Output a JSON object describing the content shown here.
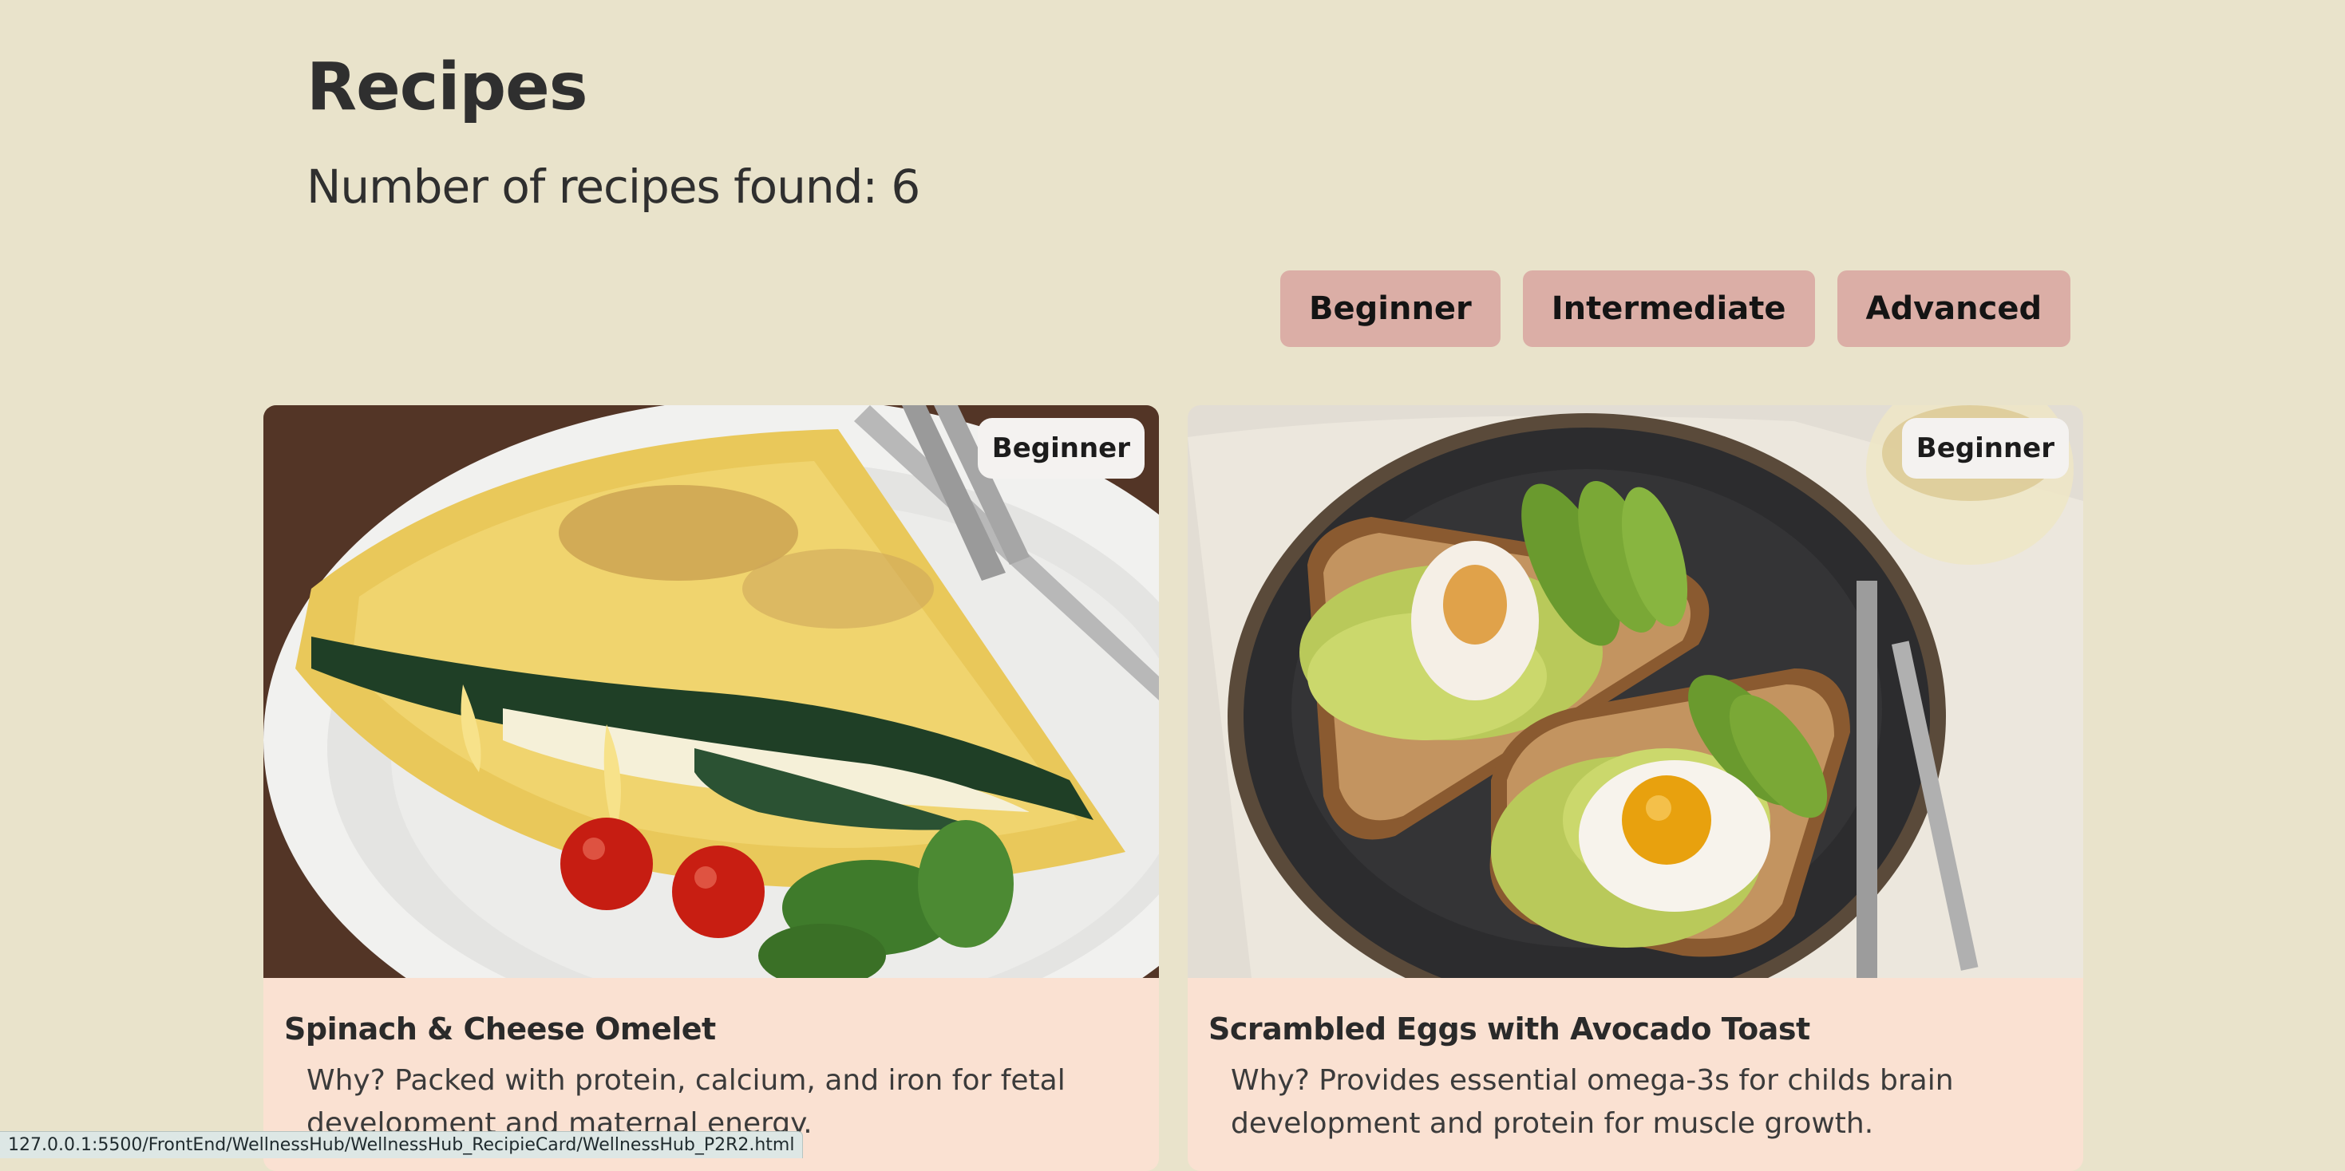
{
  "header": {
    "title": "Recipes",
    "count_label": "Number of recipes found: 6"
  },
  "filters": [
    {
      "label": "Beginner"
    },
    {
      "label": "Intermediate"
    },
    {
      "label": "Advanced"
    }
  ],
  "recipes": [
    {
      "title": "Spinach & Cheese Omelet",
      "level": "Beginner",
      "description": "Why? Packed with protein, calcium, and iron for fetal development and maternal energy."
    },
    {
      "title": "Scrambled Eggs with Avocado Toast",
      "level": "Beginner",
      "description": "Why? Provides essential omega-3s for childs brain development and protein for muscle growth."
    }
  ],
  "status_bar": {
    "url": "127.0.0.1:5500/FrontEnd/WellnessHub/WellnessHub_RecipieCard/WellnessHub_P2R2.html"
  },
  "colors": {
    "background": "#e9e3cb",
    "filter_button": "#dbaea6",
    "card_body": "#fae1d2",
    "badge": "#f4f2f0"
  }
}
